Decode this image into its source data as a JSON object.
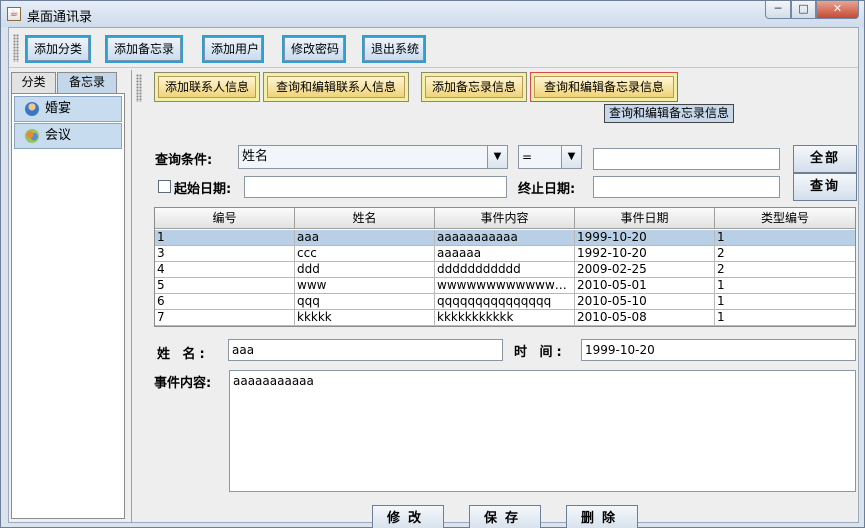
{
  "window": {
    "title": "桌面通讯录",
    "minimize": "─",
    "maximize": "□",
    "close": "✕"
  },
  "toolbar": {
    "buttons": [
      "添加分类",
      "添加备忘录",
      "添加用户",
      "修改密码",
      "退出系统"
    ]
  },
  "left": {
    "tabs": [
      "分类",
      "备忘录"
    ],
    "items": [
      {
        "label": "婚宴",
        "icon": "person-icon"
      },
      {
        "label": "会议",
        "icon": "group-icon"
      }
    ]
  },
  "actions": {
    "buttons": [
      "添加联系人信息",
      "查询和编辑联系人信息",
      "添加备忘录信息",
      "查询和编辑备忘录信息"
    ]
  },
  "tooltip": "查询和编辑备忘录信息",
  "search": {
    "condition_label": "查询条件:",
    "field_value": "姓名",
    "operator_value": "=",
    "keyword_value": "",
    "all_button": "全部",
    "start_date_label": "起始日期:",
    "start_date_value": "",
    "end_date_label": "终止日期:",
    "end_date_value": "",
    "query_button": "查询"
  },
  "table": {
    "columns": [
      "编号",
      "姓名",
      "事件内容",
      "事件日期",
      "类型编号"
    ],
    "rows": [
      [
        "1",
        "aaa",
        "aaaaaaaaaaa",
        "1999-10-20",
        "1"
      ],
      [
        "3",
        "ccc",
        "aaaaaa",
        "1992-10-20",
        "2"
      ],
      [
        "4",
        "ddd",
        "ddddddddddd",
        "2009-02-25",
        "2"
      ],
      [
        "5",
        "www",
        "wwwwwwwwwwwwww...",
        "2010-05-01",
        "1"
      ],
      [
        "6",
        "qqq",
        "qqqqqqqqqqqqqqq",
        "2010-05-10",
        "1"
      ],
      [
        "7",
        "kkkkk",
        "kkkkkkkkkkk",
        "2010-05-08",
        "1"
      ]
    ],
    "selected_row": 0
  },
  "detail": {
    "name_label": "姓 名:",
    "name_value": "aaa",
    "time_label": "时 间:",
    "time_value": "1999-10-20",
    "content_label": "事件内容:",
    "content_value": "aaaaaaaaaaa"
  },
  "bottom": {
    "modify": "修改",
    "save": "保存",
    "delete": "删除"
  }
}
